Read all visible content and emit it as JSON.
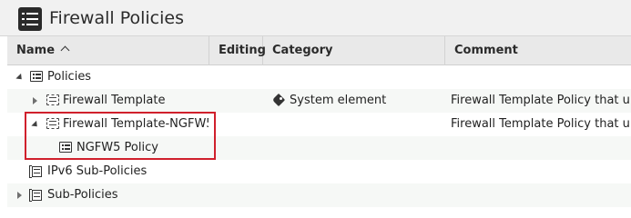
{
  "window": {
    "title": "Firewall Policies",
    "title_icon": "policy-list-icon"
  },
  "table": {
    "columns": [
      {
        "label": "Name",
        "sorted": "ascending"
      },
      {
        "label": "Editing"
      },
      {
        "label": "Category"
      },
      {
        "label": "Comment"
      }
    ],
    "rows": [
      {
        "name": "Policies",
        "icon": "policy-list-icon",
        "expanded": true,
        "category": "",
        "comment": ""
      },
      {
        "name": "Firewall Template",
        "icon": "template-policy-icon",
        "expanded": false,
        "category": "System element",
        "category_icon": "tag-icon",
        "comment": "Firewall Template Policy that u..."
      },
      {
        "name": "Firewall Template-NGFW5",
        "icon": "template-policy-icon",
        "expanded": true,
        "category": "",
        "comment": "Firewall Template Policy that u..."
      },
      {
        "name": "NGFW5 Policy",
        "icon": "policy-list-icon",
        "category": "",
        "comment": ""
      },
      {
        "name": "IPv6 Sub-Policies",
        "icon": "sub-policy-icon",
        "category": "",
        "comment": ""
      },
      {
        "name": "Sub-Policies",
        "icon": "sub-policy-icon",
        "expanded": false,
        "category": "",
        "comment": ""
      }
    ]
  },
  "colors": {
    "highlight_border": "#d0202c",
    "header_bg": "#e9e9e9",
    "row_shade": "#f6f8f6"
  }
}
